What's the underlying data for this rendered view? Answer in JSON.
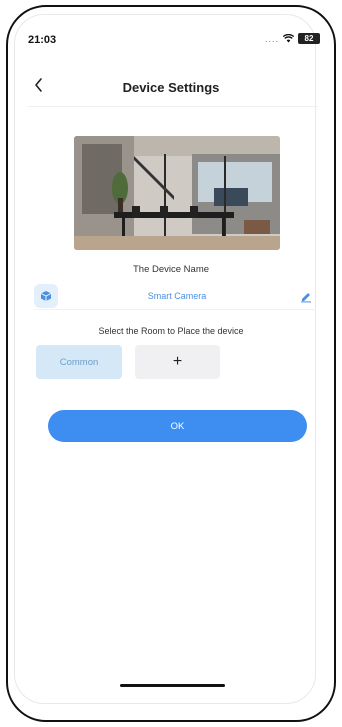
{
  "status_bar": {
    "time": "21:03",
    "signal": "....",
    "battery": "82"
  },
  "header": {
    "back_icon": "chevron-left-icon",
    "title": "Device Settings"
  },
  "device": {
    "name_label": "The Device Name",
    "name_value": "Smart Camera",
    "device_icon": "cube-icon",
    "edit_icon": "pencil-icon"
  },
  "rooms": {
    "prompt": "Select the Room to Place the device",
    "options": [
      "Common"
    ],
    "add_label": "+",
    "selected": "Common"
  },
  "actions": {
    "ok_label": "OK"
  },
  "colors": {
    "accent": "#3d8ef0",
    "chip_selected_bg": "#d5e8f7",
    "link_text": "#4a90e2"
  }
}
